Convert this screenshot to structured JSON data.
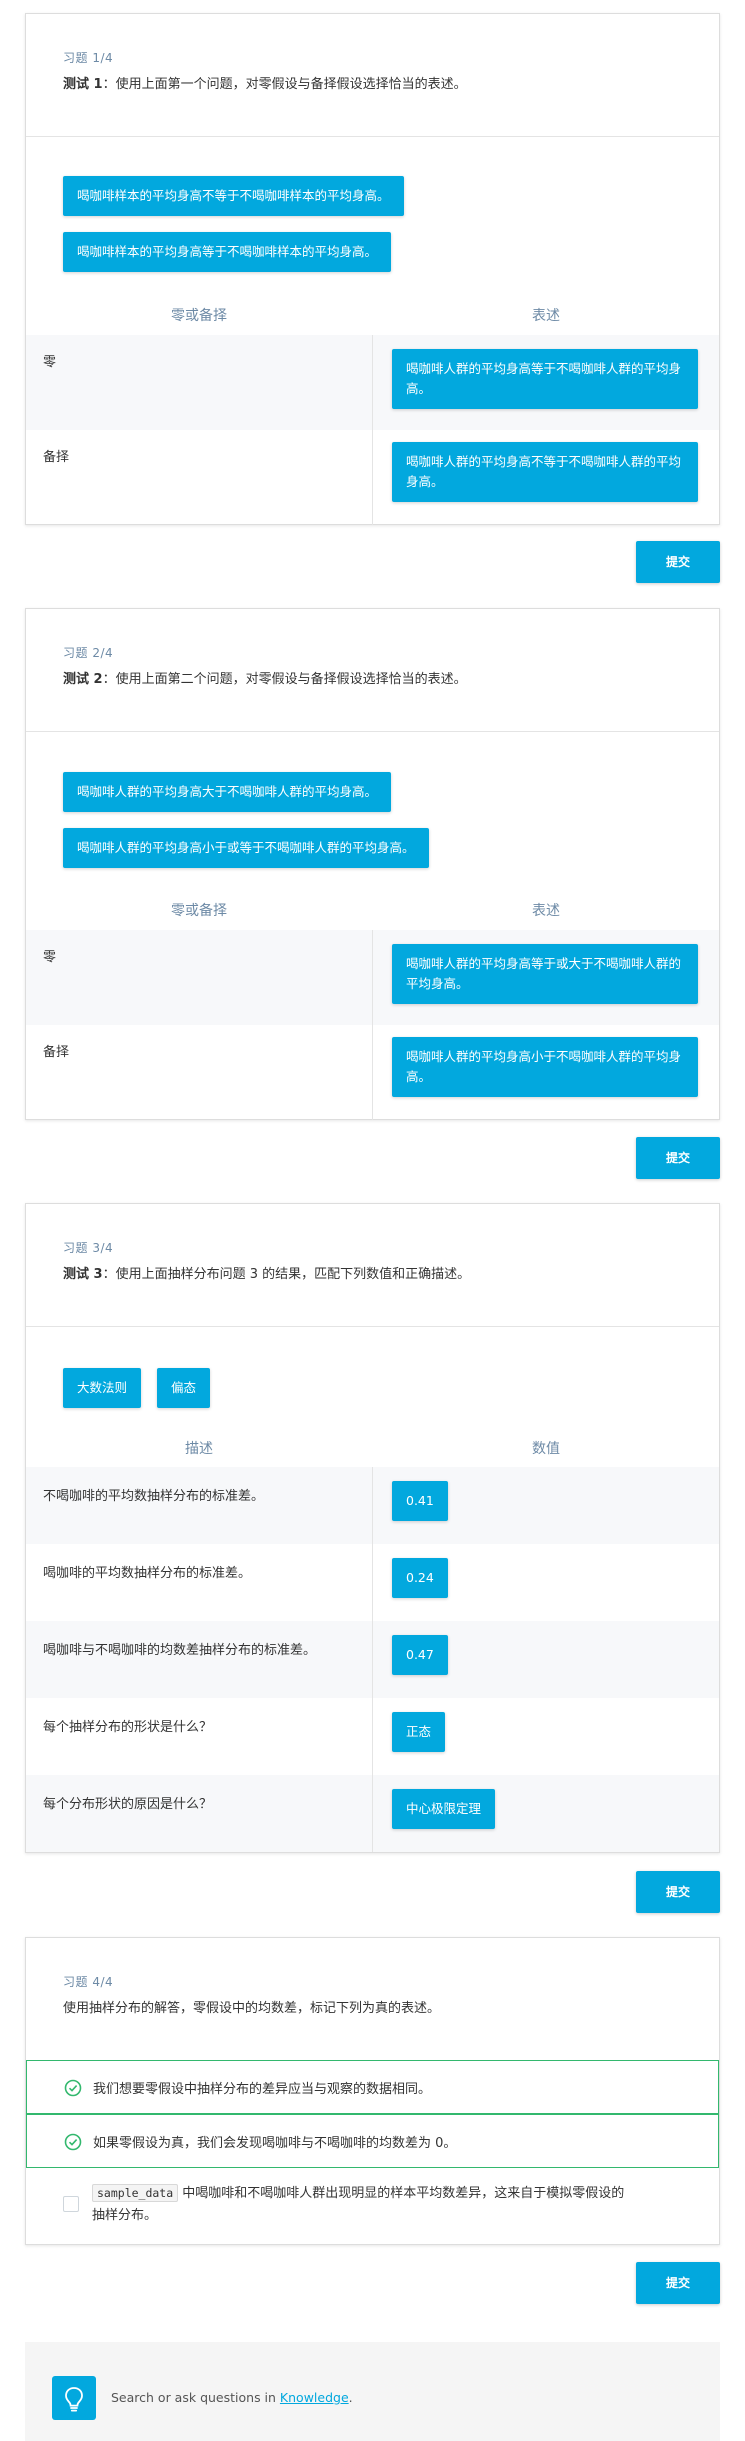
{
  "submit_label": "提交",
  "q1": {
    "label": "习题 1/4",
    "prefix": "测试 1",
    "text": "：使用上面第一个问题，对零假设与备择假设选择恰当的表述。",
    "pool": [
      "喝咖啡样本的平均身高不等于不喝咖啡样本的平均身高。",
      "喝咖啡样本的平均身高等于不喝咖啡样本的平均身高。"
    ],
    "col_left": "零或备择",
    "col_right": "表述",
    "rows": [
      {
        "label": "零",
        "answer": "喝咖啡人群的平均身高等于不喝咖啡人群的平均身高。"
      },
      {
        "label": "备择",
        "answer": "喝咖啡人群的平均身高不等于不喝咖啡人群的平均身高。"
      }
    ]
  },
  "q2": {
    "label": "习题 2/4",
    "prefix": "测试 2",
    "text": "：使用上面第二个问题，对零假设与备择假设选择恰当的表述。",
    "pool": [
      "喝咖啡人群的平均身高大于不喝咖啡人群的平均身高。",
      "喝咖啡人群的平均身高小于或等于不喝咖啡人群的平均身高。"
    ],
    "col_left": "零或备择",
    "col_right": "表述",
    "rows": [
      {
        "label": "零",
        "answer": "喝咖啡人群的平均身高等于或大于不喝咖啡人群的平均身高。"
      },
      {
        "label": "备择",
        "answer": "喝咖啡人群的平均身高小于不喝咖啡人群的平均身高。"
      }
    ]
  },
  "q3": {
    "label": "习题 3/4",
    "prefix": "测试 3",
    "text": "：使用上面抽样分布问题 3 的结果，匹配下列数值和正确描述。",
    "pool": [
      "大数法则",
      "偏态"
    ],
    "col_left": "描述",
    "col_right": "数值",
    "rows": [
      {
        "label": "不喝咖啡的平均数抽样分布的标准差。",
        "answer": "0.41"
      },
      {
        "label": "喝咖啡的平均数抽样分布的标准差。",
        "answer": "0.24"
      },
      {
        "label": "喝咖啡与不喝咖啡的均数差抽样分布的标准差。",
        "answer": "0.47"
      },
      {
        "label": "每个抽样分布的形状是什么？",
        "answer": "正态"
      },
      {
        "label": "每个分布形状的原因是什么？",
        "answer": "中心极限定理"
      }
    ]
  },
  "q4": {
    "label": "习题 4/4",
    "text": "使用抽样分布的解答，零假设中的均数差，标记下列为真的表述。",
    "options": [
      {
        "text": "我们想要零假设中抽样分布的差异应当与观察的数据相同。",
        "checked": true
      },
      {
        "text": "如果零假设为真，我们会发现喝咖啡与不喝咖啡的均数差为 0。",
        "checked": true
      },
      {
        "code": "sample_data",
        "text_line1": " 中喝咖啡和不喝咖啡人群出现明显的样本平均数差异，这来自于模拟零假设的",
        "text_line2": "抽样分布。",
        "checked": false
      }
    ]
  },
  "knowledge": {
    "prefix": "Search or ask questions in ",
    "link": "Knowledge",
    "suffix": "."
  },
  "colors": {
    "accent": "#02a8de",
    "correct": "#33b86e"
  }
}
